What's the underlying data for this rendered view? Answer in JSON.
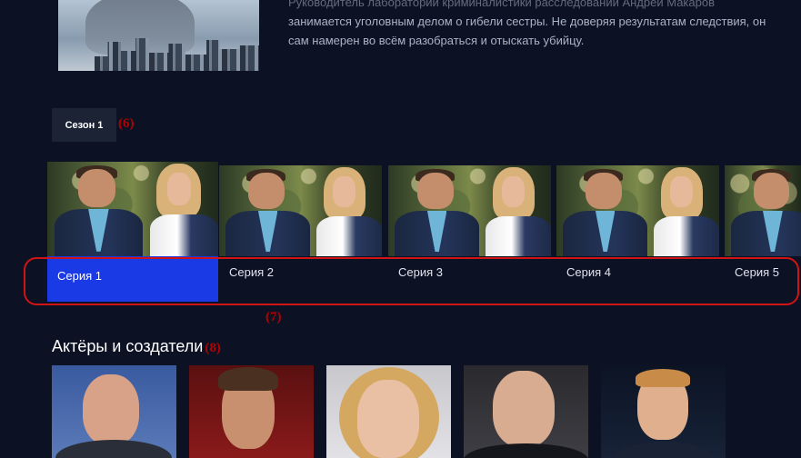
{
  "description": "занимается уголовным делом о гибели сестры. Не доверяя результатам следствия, он сам намерен во всём разобраться и отыскать убийцу.",
  "description_top": "Руководитель лаборатории криминалистики расследований Андрей Макаров",
  "seasons": [
    {
      "label": "Сезон 1",
      "active": true
    }
  ],
  "annotations": {
    "season": "(6)",
    "episodes": "(7)",
    "cast": "(8)"
  },
  "episodes": [
    {
      "label": "Серия 1",
      "active": true
    },
    {
      "label": "Серия 2",
      "active": false
    },
    {
      "label": "Серия 3",
      "active": false
    },
    {
      "label": "Серия 4",
      "active": false
    },
    {
      "label": "Серия 5",
      "active": false
    }
  ],
  "cast": {
    "heading": "Актёры и создатели",
    "members": [
      {
        "name": ""
      },
      {
        "name": ""
      },
      {
        "name": ""
      },
      {
        "name": ""
      },
      {
        "name": ""
      }
    ]
  },
  "colors": {
    "background": "#0c1223",
    "accent": "#1a3ae6",
    "highlight": "#d01414"
  }
}
